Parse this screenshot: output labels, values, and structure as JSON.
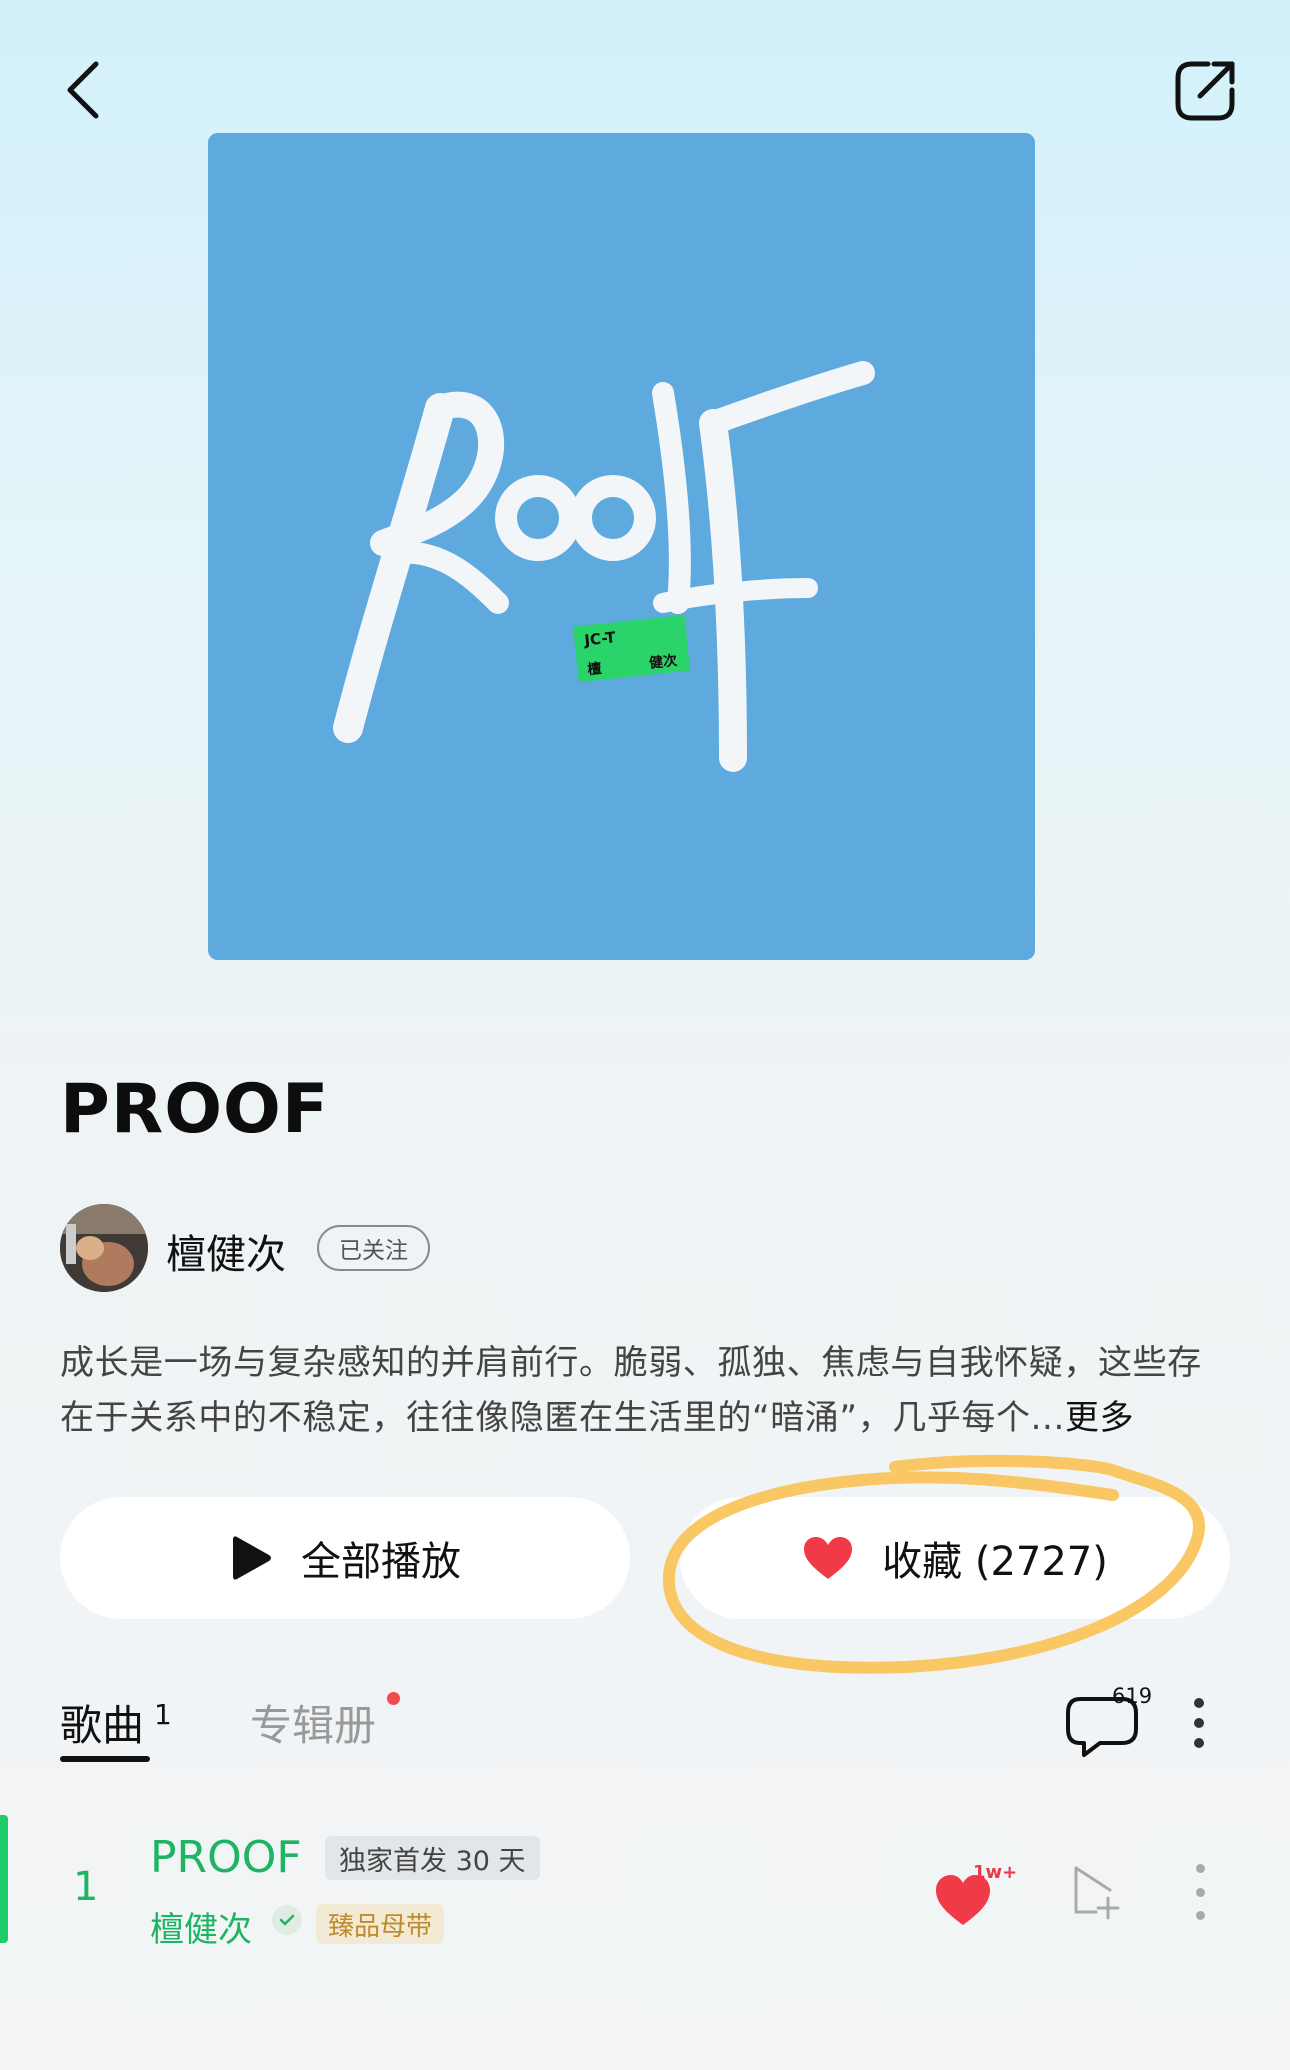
{
  "header": {
    "back_icon": "chevron-left-icon",
    "share_icon": "share-icon"
  },
  "cover": {
    "background": "#5ea9de",
    "tag_top": "JC-T",
    "tag_bottom_left": "檀",
    "tag_bottom_right": "健次",
    "tag_color": "#2bd46a"
  },
  "album": {
    "title": "PROOF",
    "artist": "檀健次",
    "follow_label": "已关注",
    "description": "成长是一场与复杂感知的并肩前行。脆弱、孤独、焦虑与自我怀疑，这些存在于关系中的不稳定，往往像隐匿在生活里的“暗涌”，几乎每个...",
    "more_label": "更多"
  },
  "actions": {
    "play_all_label": "全部播放",
    "collect_label": "收藏 (2727)",
    "highlight_color": "#f9c865",
    "like_color": "#f03a48"
  },
  "tabs": {
    "songs_label": "歌曲",
    "songs_count": "1",
    "album_label": "专辑册",
    "comment_count": "619"
  },
  "tracks": [
    {
      "number": "1",
      "title": "PROOF",
      "badge": "独家首发 30 天",
      "artist": "檀健次",
      "quality": "臻品母带",
      "like_count": "1w+"
    }
  ],
  "colors": {
    "accent_green": "#1fb463",
    "badge_gold": "#c08b2c"
  }
}
